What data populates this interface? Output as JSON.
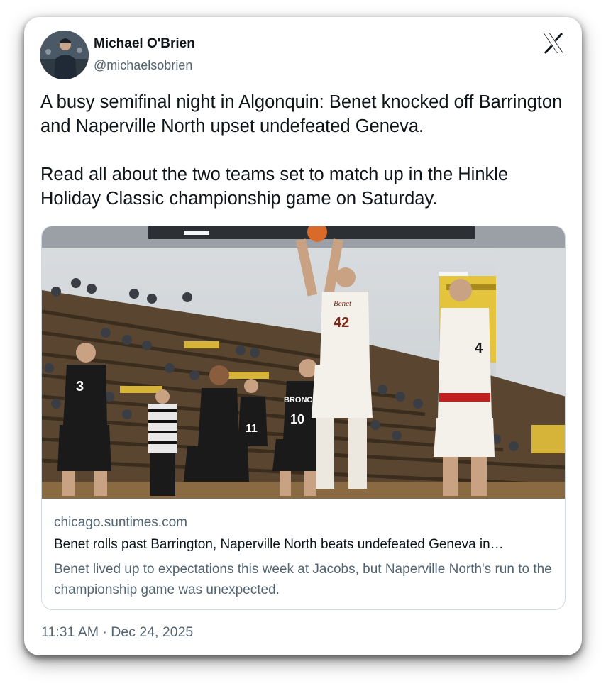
{
  "author": {
    "name": "Michael O'Brien",
    "handle": "@michaelsobrien"
  },
  "tweet": {
    "text": "A busy semifinal night in Algonquin: Benet knocked off Barrington and Naperville North upset undefeated Geneva.\n\nRead all about the two teams set to match up in the Hinkle Holiday Classic championship game on Saturday."
  },
  "link_card": {
    "domain": "chicago.suntimes.com",
    "headline": "Benet rolls past Barrington, Naperville North beats undefeated Geneva in…",
    "description": "Benet lived up to expectations this week at Jacobs, but Naperville North's run to the championship game was unexpected.",
    "photo_jerseys": {
      "shooter": "42",
      "left_player": "3",
      "center_player": "11",
      "broncos_player": "10",
      "right_player": "4",
      "broncos_text": "BRONCOS",
      "benet_text": "Benet"
    }
  },
  "timestamp": "11:31 AM · Dec 24, 2025",
  "icons": {
    "platform": "x-logo-icon"
  },
  "colors": {
    "text_primary": "#0f1419",
    "text_secondary": "#536471",
    "border": "#cfd9de"
  }
}
